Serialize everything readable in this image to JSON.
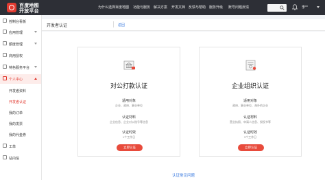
{
  "header": {
    "logo_line1": "百度地图",
    "logo_line2": "开放平台",
    "nav": [
      "为什么选择百度地图",
      "功能与服务",
      "解决方案",
      "开发文档",
      "反馈与帮助",
      "服务升级",
      "账号问题反馈"
    ],
    "username": "李**",
    "colors": {
      "bar": "#2d2f36"
    }
  },
  "sidebar": {
    "items": [
      {
        "label": "控制台看板",
        "icon": "dashboard-icon"
      },
      {
        "label": "应用管理",
        "icon": "app-icon"
      },
      {
        "label": "额度管理",
        "icon": "quota-icon"
      },
      {
        "label": "商用授权",
        "icon": "license-icon"
      },
      {
        "label": "特色服务平台",
        "icon": "service-icon"
      },
      {
        "label": "个人中心",
        "icon": "user-icon"
      },
      {
        "label": "工单",
        "icon": "ticket-icon"
      },
      {
        "label": "站内信",
        "icon": "message-icon"
      }
    ],
    "subitems": [
      "开发者资料",
      "开发者认证",
      "我的订单",
      "我的发票",
      "我的代金券"
    ],
    "active_sub": "开发者认证"
  },
  "breadcrumb": {
    "title": "开发者认证",
    "link": "返回"
  },
  "cards": [
    {
      "title": "对公打款认证",
      "target_label": "适用对象",
      "target_value": "企业、政府、事业单位",
      "material_label": "认证材料",
      "material_value": "企业信息、企业对公账号等信息",
      "time_label": "认证时效",
      "time_value": "1个工作日",
      "button": "立即认证",
      "icon": "bank-transfer-icon"
    },
    {
      "title": "企业组织认证",
      "target_label": "适用对象",
      "target_value": "政府、事业单位、海外的企业",
      "material_label": "认证材料",
      "material_value": "营业执照、申请人信息、授权书等",
      "time_label": "认证时效",
      "time_value": "3个工作日",
      "button": "立即认证",
      "icon": "enterprise-cert-icon"
    }
  ],
  "faq_link": "认证常见问题",
  "accent": "#e84b3c"
}
